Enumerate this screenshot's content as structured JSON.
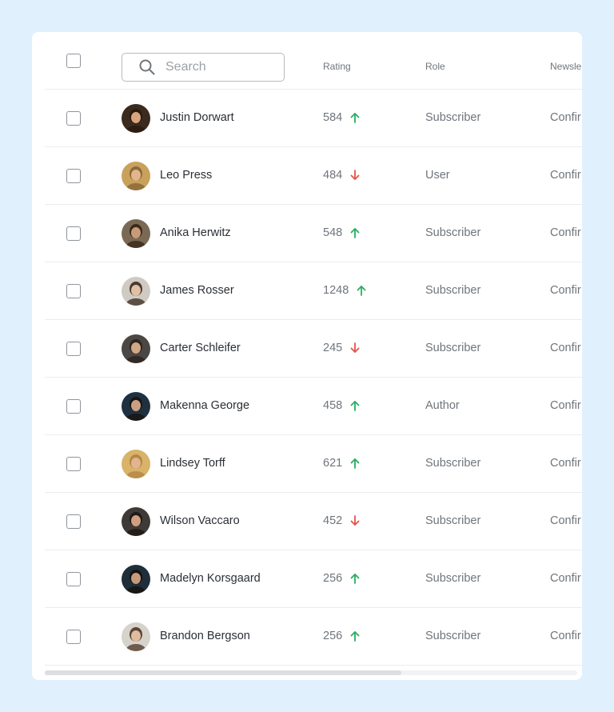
{
  "search": {
    "placeholder": "Search",
    "value": ""
  },
  "columns": {
    "rating": "Rating",
    "role": "Role",
    "newsletter": "Newsle"
  },
  "colors": {
    "up": "#27ae60",
    "down": "#e5534b"
  },
  "users": [
    {
      "name": "Justin Dorwart",
      "rating": "584",
      "trend": "up",
      "role": "Subscriber",
      "newsletter": "Confir",
      "avatar": {
        "bg": "#3b2a1e",
        "skin": "#d9a47e",
        "hair": "#2b1a10"
      }
    },
    {
      "name": "Leo Press",
      "rating": "484",
      "trend": "down",
      "role": "User",
      "newsletter": "Confir",
      "avatar": {
        "bg": "#c9a15a",
        "skin": "#e2b58d",
        "hair": "#8a6a3c"
      }
    },
    {
      "name": "Anika Herwitz",
      "rating": "548",
      "trend": "up",
      "role": "Subscriber",
      "newsletter": "Confir",
      "avatar": {
        "bg": "#7a6a55",
        "skin": "#c99a78",
        "hair": "#3a2a1c"
      }
    },
    {
      "name": "James Rosser",
      "rating": "1248",
      "trend": "up",
      "role": "Subscriber",
      "newsletter": "Confir",
      "avatar": {
        "bg": "#cfcac3",
        "skin": "#e2c0a4",
        "hair": "#4a3a2e"
      }
    },
    {
      "name": "Carter Schleifer",
      "rating": "245",
      "trend": "down",
      "role": "Subscriber",
      "newsletter": "Confir",
      "avatar": {
        "bg": "#4a4744",
        "skin": "#d2a786",
        "hair": "#2e2520"
      }
    },
    {
      "name": "Makenna George",
      "rating": "458",
      "trend": "up",
      "role": "Author",
      "newsletter": "Confir",
      "avatar": {
        "bg": "#1f3140",
        "skin": "#caa085",
        "hair": "#1a1512"
      }
    },
    {
      "name": "Lindsey Torff",
      "rating": "621",
      "trend": "up",
      "role": "Subscriber",
      "newsletter": "Confir",
      "avatar": {
        "bg": "#d8b368",
        "skin": "#e3b48f",
        "hair": "#b58846"
      }
    },
    {
      "name": "Wilson Vaccaro",
      "rating": "452",
      "trend": "down",
      "role": "Subscriber",
      "newsletter": "Confir",
      "avatar": {
        "bg": "#3d3a37",
        "skin": "#cf9f80",
        "hair": "#201a16"
      }
    },
    {
      "name": "Madelyn Korsgaard",
      "rating": "256",
      "trend": "up",
      "role": "Subscriber",
      "newsletter": "Confir",
      "avatar": {
        "bg": "#1e2e3b",
        "skin": "#c69b7d",
        "hair": "#171310"
      }
    },
    {
      "name": "Brandon Bergson",
      "rating": "256",
      "trend": "up",
      "role": "Subscriber",
      "newsletter": "Confir",
      "avatar": {
        "bg": "#d6d2cc",
        "skin": "#e0bb9d",
        "hair": "#5a4636"
      }
    }
  ]
}
